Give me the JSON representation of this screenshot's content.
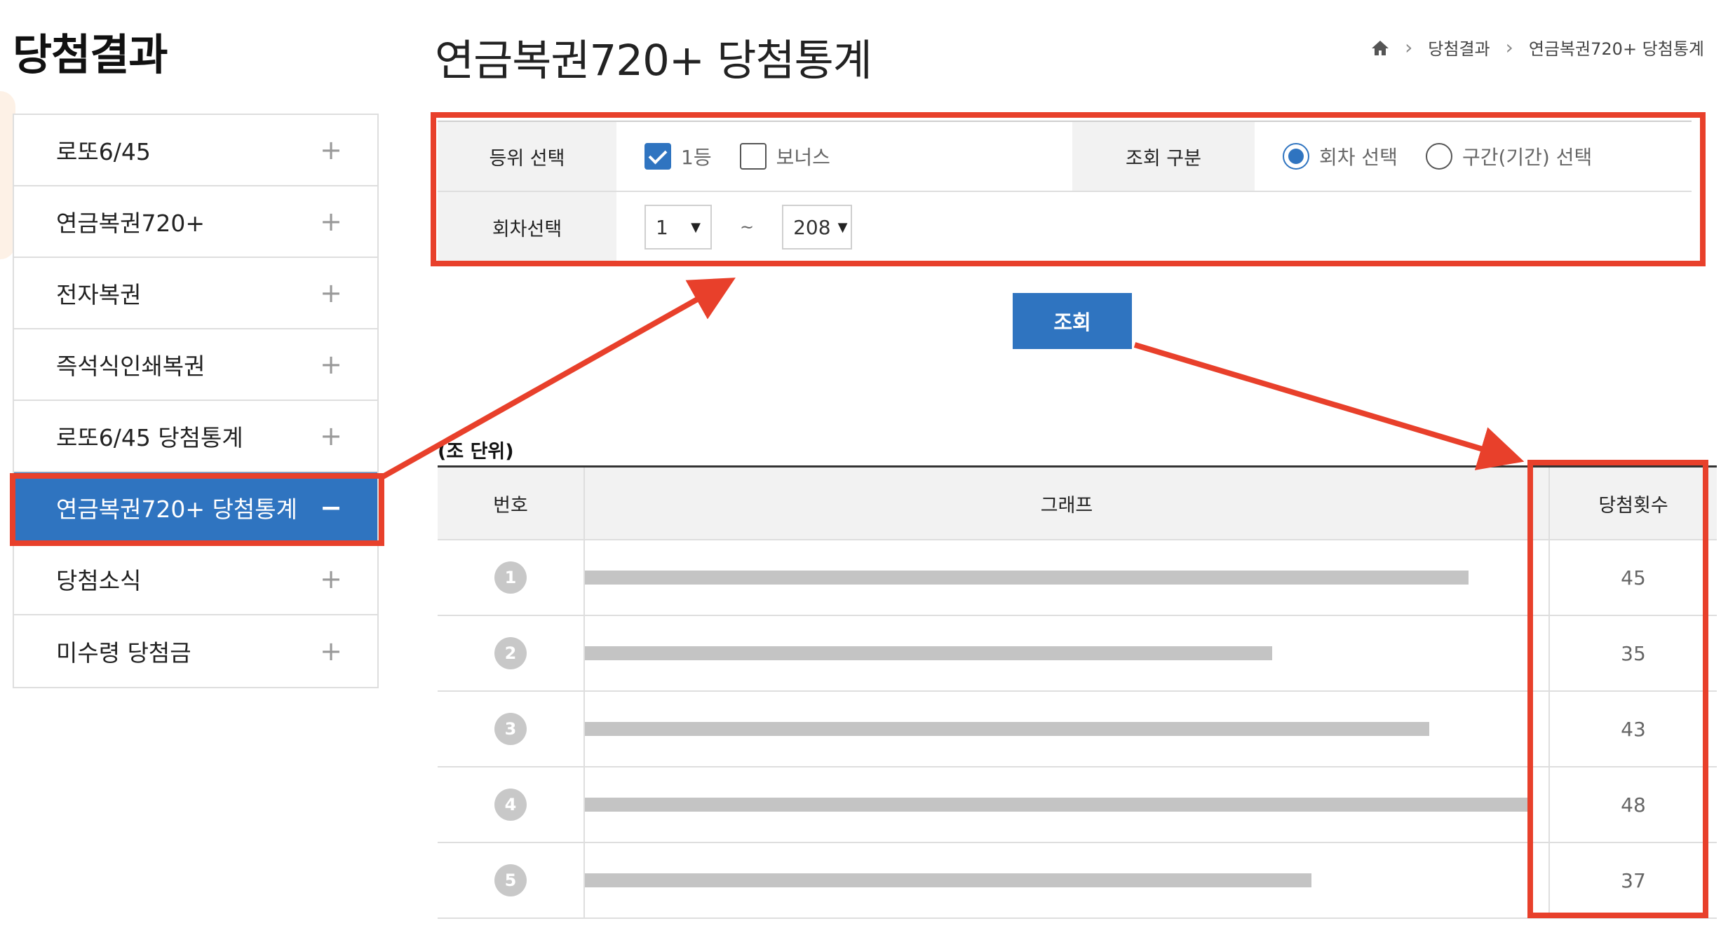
{
  "side_title": "당첨결과",
  "page_title": "연금복권720+ 당첨통계",
  "breadcrumb": [
    "당첨결과",
    "연금복권720+ 당첨통계"
  ],
  "sidebar": {
    "items": [
      {
        "label": "로또6/45",
        "toggle": "+"
      },
      {
        "label": "연금복권720+",
        "toggle": "+"
      },
      {
        "label": "전자복권",
        "toggle": "+"
      },
      {
        "label": "즉석식인쇄복권",
        "toggle": "+"
      },
      {
        "label": "로또6/45 당첨통계",
        "toggle": "+"
      },
      {
        "label": "연금복권720+ 당첨통계",
        "toggle": "−"
      },
      {
        "label": "당첨소식",
        "toggle": "+"
      },
      {
        "label": "미수령 당첨금",
        "toggle": "+"
      }
    ],
    "active_index": 5
  },
  "filter": {
    "rank_label": "등위 선택",
    "rank_options": [
      {
        "label": "1등",
        "checked": true
      },
      {
        "label": "보너스",
        "checked": false
      }
    ],
    "query_type_label": "조회 구분",
    "query_type_options": [
      {
        "label": "회차 선택",
        "selected": true
      },
      {
        "label": "구간(기간) 선택",
        "selected": false
      }
    ],
    "round_label": "회차선택",
    "round_from": "1",
    "round_sep": "~",
    "round_to": "208"
  },
  "search_button": "조회",
  "results": {
    "unit_label": "(조 단위)",
    "headers": {
      "no": "번호",
      "graph": "그래프",
      "count": "당첨횟수"
    },
    "rows": [
      {
        "no": "1",
        "count": "45",
        "value": 45
      },
      {
        "no": "2",
        "count": "35",
        "value": 35
      },
      {
        "no": "3",
        "count": "43",
        "value": 43
      },
      {
        "no": "4",
        "count": "48",
        "value": 48
      },
      {
        "no": "5",
        "count": "37",
        "value": 37
      }
    ],
    "max_value": 48
  },
  "colors": {
    "accent": "#2f74c0",
    "annotation": "#e8402b",
    "bar": "#c4c4c4"
  }
}
